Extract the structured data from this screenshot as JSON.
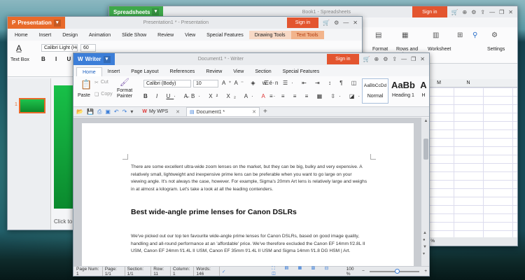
{
  "spreadsheets": {
    "app_label": "Spreadsheets",
    "title": "Book1 - Spreadsheets",
    "signin": "Sign in",
    "ribbon": [
      "Format",
      "Rows and Columns",
      "Worksheet",
      "Settings"
    ],
    "columns": [
      "M",
      "N"
    ]
  },
  "presentation": {
    "app_label": "Presentation",
    "title": "Presentation1 * - Presentation",
    "signin": "Sign in",
    "menu": [
      "Home",
      "Insert",
      "Design",
      "Animation",
      "Slide Show",
      "Review",
      "View",
      "Special Features",
      "Drawing Tools",
      "Text Tools"
    ],
    "textbox": "Text Box",
    "font": "Calibri Light (He",
    "size": "60",
    "slide_num": "1",
    "click_to": "Click to"
  },
  "writer": {
    "app_label": "Writer",
    "title": "Document1 * - Writer",
    "signin": "Sign in",
    "menu": [
      "Home",
      "Insert",
      "Page Layout",
      "References",
      "Review",
      "View",
      "Section",
      "Special Features"
    ],
    "paste": "Paste",
    "cut": "Cut",
    "copy": "Copy",
    "format_painter_1": "Format",
    "format_painter_2": "Painter",
    "font": "Calibri (Body)",
    "size": "10",
    "styles": [
      {
        "preview": "AaBbCcDd",
        "name": "Normal"
      },
      {
        "preview": "AaBb",
        "name": "Heading 1"
      },
      {
        "preview": "A",
        "name": "H"
      }
    ],
    "tabs": {
      "mywps": "My WPS",
      "doc": "Document1 *"
    },
    "para1": "There are some excellent ultra-wide zoom lenses on the market, but they can be big, bulky and very expensive. A relatively small, lightweight and inexpensive prime lens can be preferable when you want to go large on your viewing angle. It's not always the case, however. For example, Sigma's 20mm Art lens is relatively large and weighs in at almost a kilogram. Let's take a look at all the leading contenders.",
    "heading": "Best wide-angle prime lenses for Canon DSLRs",
    "para2": "We've picked out our top ten favourite wide-angle prime lenses for Canon DSLRs, based on good image quality, handling and all-round performance at an 'affordable' price. We've therefore excluded the Canon EF 14mm f/2.8L II USM, Canon EF 24mm f/1.4L II USM, Canon EF 35mm f/1.4L II USM and Sigma 14mm f/1.8 DG HSM | Art.",
    "status": {
      "page_num": "Page Num: 1",
      "page": "Page: 1/1",
      "section": "Section: 1/1",
      "row": "Row: 11",
      "column": "Column: 1",
      "words": "Words: 146",
      "zoom": "100 %"
    }
  },
  "behind_zoom": "0 %",
  "colors": {
    "writer": "#3c7ed8",
    "presentation": "#e86a2a",
    "spreadsheets": "#3ea84a",
    "signin": "#e3552f"
  }
}
